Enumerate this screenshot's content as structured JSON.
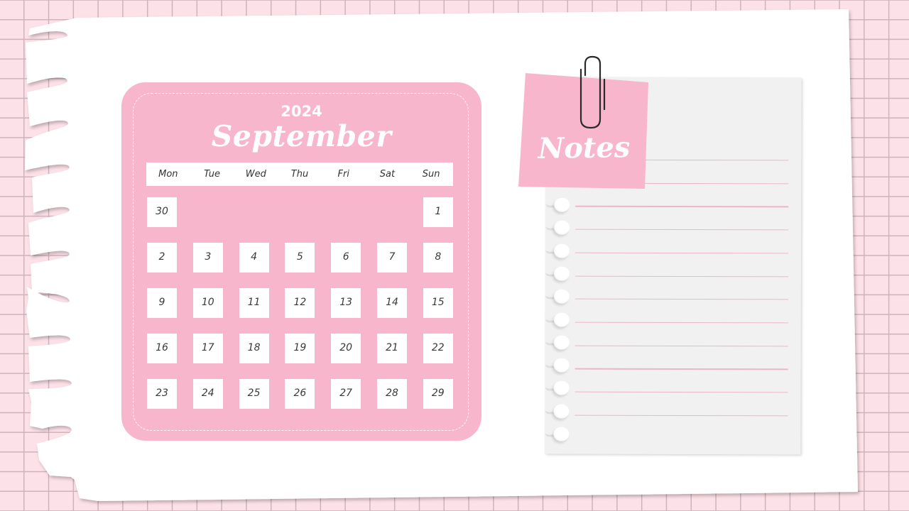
{
  "calendar": {
    "year": "2024",
    "month": "September",
    "weekdays": [
      "Mon",
      "Tue",
      "Wed",
      "Thu",
      "Fri",
      "Sat",
      "Sun"
    ],
    "weeks": [
      [
        "30",
        "",
        "",
        "",
        "",
        "",
        "1"
      ],
      [
        "2",
        "3",
        "4",
        "5",
        "6",
        "7",
        "8"
      ],
      [
        "9",
        "10",
        "11",
        "12",
        "13",
        "14",
        "15"
      ],
      [
        "16",
        "17",
        "18",
        "19",
        "20",
        "21",
        "22"
      ],
      [
        "23",
        "24",
        "25",
        "26",
        "27",
        "28",
        "29"
      ]
    ]
  },
  "notes": {
    "title": "Notes",
    "line_count": 12,
    "ring_count": 11
  },
  "colors": {
    "accent_pink": "#f8b6cc",
    "background_pink": "#fde1e9",
    "note_line": "#ecb6c8",
    "notes_paper": "#f1f1f1"
  }
}
